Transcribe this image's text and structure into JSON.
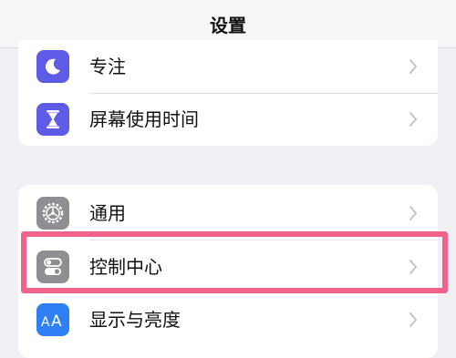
{
  "nav": {
    "title": "设置"
  },
  "group1": {
    "items": [
      {
        "label": "专注",
        "icon": "moon-icon",
        "color": "#5e5ce6"
      },
      {
        "label": "屏幕使用时间",
        "icon": "hourglass-icon",
        "color": "#5e5ce6"
      }
    ]
  },
  "group2": {
    "items": [
      {
        "label": "通用",
        "icon": "gear-icon",
        "color": "#8e8e93"
      },
      {
        "label": "控制中心",
        "icon": "toggles-icon",
        "color": "#8e8e93"
      },
      {
        "label": "显示与亮度",
        "icon": "text-size-icon",
        "color": "#2f7ff5"
      }
    ]
  },
  "colors": {
    "highlight": "#f0628c",
    "background": "#f0f0f5"
  }
}
